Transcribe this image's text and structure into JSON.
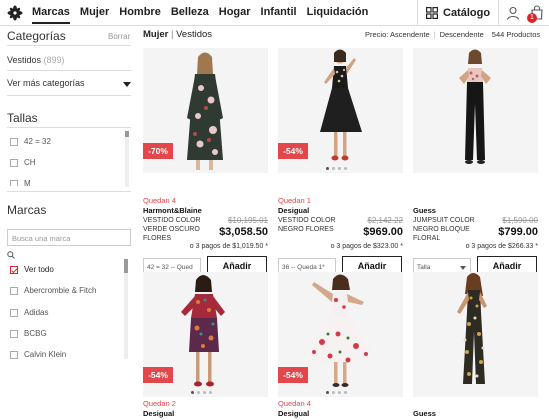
{
  "nav": {
    "items": [
      "Marcas",
      "Mujer",
      "Hombre",
      "Belleza",
      "Hogar",
      "Infantil",
      "Liquidación"
    ],
    "catalog_label": "Catálogo",
    "bag_count": "1"
  },
  "sidebar": {
    "categorias_title": "Categorías",
    "borrar": "Borrar",
    "vestidos_label": "Vestidos",
    "vestidos_count": "(899)",
    "more_categories": "Ver más categorías",
    "tallas_title": "Tallas",
    "tallas": [
      "42 = 32",
      "CH",
      "M"
    ],
    "marcas_title": "Marcas",
    "brand_search_placeholder": "Busca una marca",
    "brands": [
      "Ver todo",
      "Abercrombie & Fitch",
      "Adidas",
      "BCBG",
      "Calvin Klein"
    ]
  },
  "header": {
    "crumb_mujer": "Mujer",
    "crumb_sep": "|",
    "crumb_vestidos": "Vestidos",
    "sort_prefix": "Precio: Ascendente",
    "sort_div": "|",
    "sort_desc": "Descendente",
    "product_count": "544 Productos"
  },
  "products": [
    {
      "discount": "-70%",
      "quedan": "Quedan 4",
      "brand": "Harmont&Blaine",
      "desc": "VESTIDO COLOR VERDE OSCURO FLORES",
      "old_price": "$10,195.01",
      "price": "$3,058.50",
      "installments": "o 3 pagos de $1,019.50 *",
      "size": "42 = 32 -- Qued",
      "add": "Añadir"
    },
    {
      "discount": "-54%",
      "quedan": "Quedan 1",
      "brand": "Desigual",
      "desc": "VESTIDO COLOR NEGRO FLORES",
      "old_price": "$2,142.22",
      "price": "$969.00",
      "installments": "o 3 pagos de $323.00 *",
      "size": "36 -- Queda 1*",
      "add": "Añadir"
    },
    {
      "discount": "",
      "quedan": "",
      "brand": "Guess",
      "desc": "JUMPSUIT COLOR NEGRO BLOQUE FLORAL",
      "old_price": "$1,590.00",
      "price": "$799.00",
      "installments": "o 3 pagos de $266.33 *",
      "size": "Talla",
      "add": "Añadir"
    },
    {
      "discount": "-54%",
      "quedan": "Quedan 2",
      "brand": "Desigual"
    },
    {
      "discount": "-54%",
      "quedan": "Quedan 4",
      "brand": "Desigual"
    },
    {
      "discount": "",
      "quedan": "",
      "brand": "Guess"
    }
  ]
}
